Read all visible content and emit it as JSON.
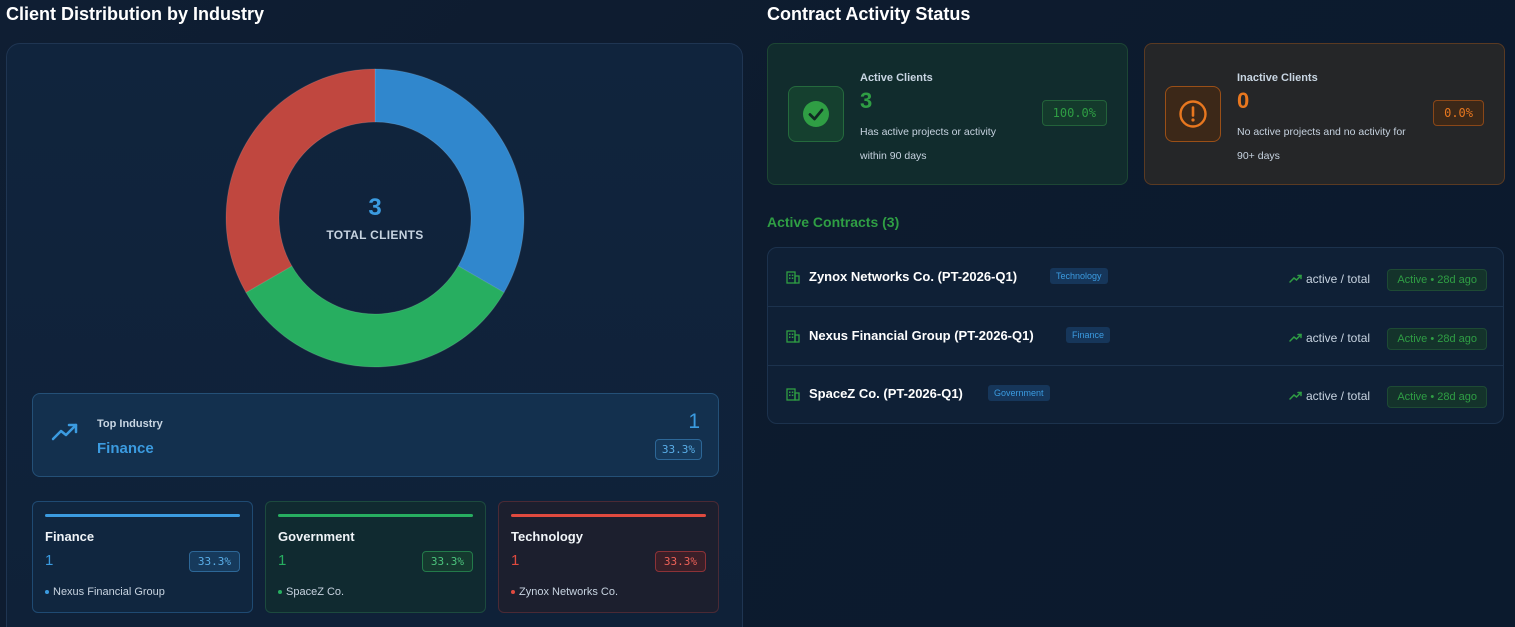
{
  "distribution": {
    "title": "Client Distribution by Industry",
    "total_value": "3",
    "total_label": "TOTAL CLIENTS",
    "chart_data": {
      "type": "pie",
      "categories": [
        "Finance",
        "Government",
        "Technology"
      ],
      "values": [
        1,
        1,
        1
      ],
      "colors": [
        "#3087cd",
        "#27ae60",
        "#c0473f"
      ]
    },
    "top_industry": {
      "icon": "trending-up-icon",
      "label": "Top Industry",
      "value": "Finance",
      "count": "1",
      "percent": "33.3%"
    },
    "industries": [
      {
        "name": "Finance",
        "count": "1",
        "percent": "33.3%",
        "client": "Nexus Financial Group",
        "color": "#3b9be0"
      },
      {
        "name": "Government",
        "count": "1",
        "percent": "33.3%",
        "client": "SpaceZ Co.",
        "color": "#27ae60"
      },
      {
        "name": "Technology",
        "count": "1",
        "percent": "33.3%",
        "client": "Zynox Networks Co.",
        "color": "#e04a3f"
      }
    ]
  },
  "contract_status": {
    "title": "Contract Activity Status",
    "active": {
      "icon": "check-circle-icon",
      "label": "Active Clients",
      "count": "3",
      "description": "Has active projects or activity within 90 days",
      "percent": "100.0%",
      "color": "#2f9e44"
    },
    "inactive": {
      "icon": "alert-circle-icon",
      "label": "Inactive Clients",
      "count": "0",
      "description": "No active projects and no activity for 90+ days",
      "percent": "0.0%",
      "color": "#e8771f"
    },
    "active_contracts_header": "Active Contracts (3)",
    "contracts": [
      {
        "name": "Zynox Networks Co. (PT-2026-Q1)",
        "tag": "Technology",
        "activity": "active / total",
        "status": "Active • 28d ago"
      },
      {
        "name": "Nexus Financial Group (PT-2026-Q1)",
        "tag": "Finance",
        "activity": "active / total",
        "status": "Active • 28d ago"
      },
      {
        "name": "SpaceZ Co. (PT-2026-Q1)",
        "tag": "Government",
        "activity": "active / total",
        "status": "Active • 28d ago"
      }
    ]
  }
}
